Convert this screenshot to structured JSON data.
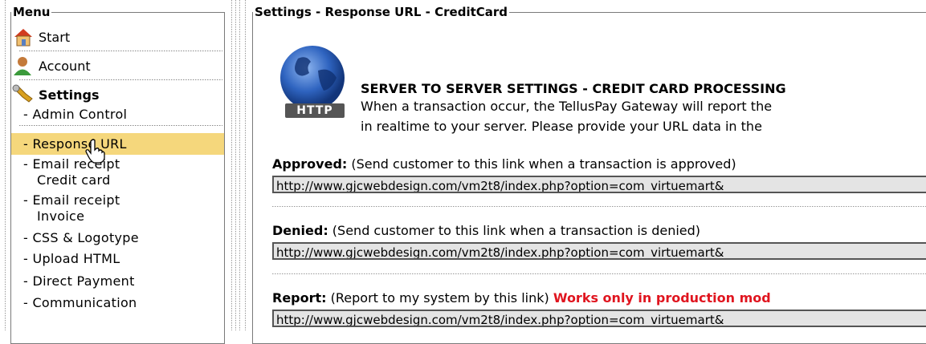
{
  "menu": {
    "legend": "Menu",
    "start": "Start",
    "account": "Account",
    "settings": "Settings",
    "sub_items": [
      "- Admin Control",
      "- Response URL",
      "- Email receipt",
      "Credit card",
      "- Email receipt",
      "Invoice",
      "- CSS & Logotype",
      "- Upload HTML",
      "- Direct Payment",
      "- Communication"
    ],
    "highlight_color": "#f5d77c"
  },
  "settings": {
    "legend": "Settings - Response URL - CreditCard",
    "icon_label": "HTTP",
    "heading": "SERVER TO SERVER SETTINGS - CREDIT CARD PROCESSING",
    "desc1": "When a transaction occur, the TellusPay Gateway will report the",
    "desc2": "in realtime to your server. Please provide your URL data in the",
    "approved_label": "Approved:",
    "approved_note": " (Send customer to this link when a transaction is approved)",
    "approved_url": "http://www.gjcwebdesign.com/vm2t8/index.php?option=com_virtuemart&",
    "denied_label": "Denied:",
    "denied_note": " (Send customer to this link when a transaction is denied)",
    "denied_url": "http://www.gjcwebdesign.com/vm2t8/index.php?option=com_virtuemart&",
    "report_label": "Report:",
    "report_note": " (Report to my system by this link) ",
    "report_warning": "Works only in production mod",
    "report_url": "http://www.gjcwebdesign.com/vm2t8/index.php?option=com_virtuemart&"
  },
  "colors": {
    "warning": "#e0151f",
    "url_bg": "#e4e4e4"
  }
}
